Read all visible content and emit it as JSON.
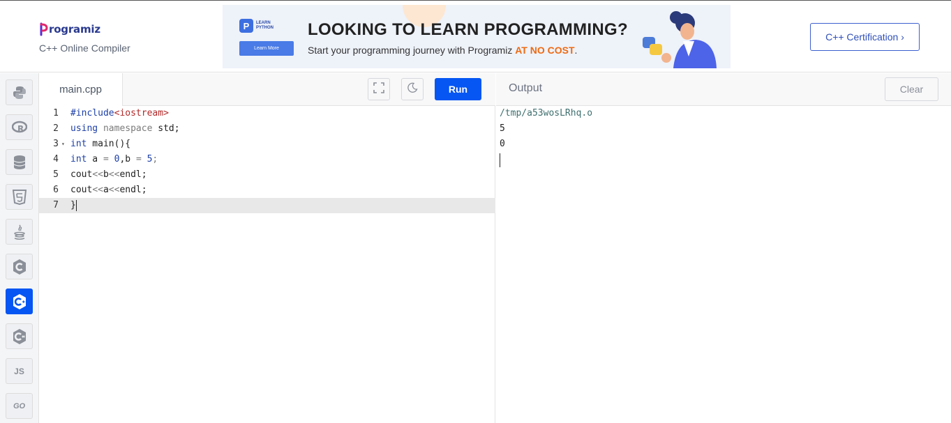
{
  "header": {
    "logo_text": "rogramiz",
    "subtitle": "C++ Online Compiler",
    "certification_button": "C++ Certification ›"
  },
  "ad": {
    "badge_letter": "P",
    "badge_line1": "LEARN",
    "badge_line2": "PYTHON",
    "learn_more": "Learn More",
    "headline": "LOOKING TO LEARN PROGRAMMING?",
    "tagline_prefix": "Start your programming journey with Programiz ",
    "tagline_accent": "AT NO COST",
    "tagline_suffix": "."
  },
  "sidebar": {
    "languages": [
      {
        "name": "python",
        "icon": "python-icon"
      },
      {
        "name": "r",
        "icon": "r-icon"
      },
      {
        "name": "sql",
        "icon": "database-icon"
      },
      {
        "name": "html",
        "icon": "html5-icon"
      },
      {
        "name": "java",
        "icon": "java-icon"
      },
      {
        "name": "c",
        "icon": "c-icon"
      },
      {
        "name": "cpp",
        "icon": "cpp-icon",
        "active": true
      },
      {
        "name": "csharp",
        "icon": "csharp-icon"
      },
      {
        "name": "javascript",
        "icon": "js-icon",
        "label": "JS"
      },
      {
        "name": "go",
        "icon": "go-icon",
        "label": "GO"
      }
    ]
  },
  "editor": {
    "file_tab": "main.cpp",
    "run_label": "Run",
    "line_numbers": [
      "1",
      "2",
      "3",
      "4",
      "5",
      "6",
      "7"
    ],
    "lines": {
      "l1_a": "#include",
      "l1_b": "<iostream>",
      "l2_a": "using",
      "l2_b": "namespace",
      "l2_c": "std;",
      "l3_a": "int",
      "l3_b": " main(){",
      "l4_a": "int",
      "l4_b": " a ",
      "l4_c": "=",
      "l4_d": " ",
      "l4_e": "0",
      "l4_f": ",b ",
      "l4_g": "=",
      "l4_h": " ",
      "l4_i": "5",
      "l4_j": ";",
      "l5_a": "cout",
      "l5_b": "<<",
      "l5_c": "b",
      "l5_d": "<<",
      "l5_e": "endl;",
      "l6_a": "cout",
      "l6_b": "<<",
      "l6_c": "a",
      "l6_d": "<<",
      "l6_e": "endl;",
      "l7_a": "}"
    }
  },
  "output": {
    "title": "Output",
    "clear_label": "Clear",
    "lines": [
      "/tmp/a53wosLRhq.o",
      "5",
      "0"
    ]
  },
  "colors": {
    "accent": "#0556f3",
    "ad_accent": "#ee6a12"
  }
}
